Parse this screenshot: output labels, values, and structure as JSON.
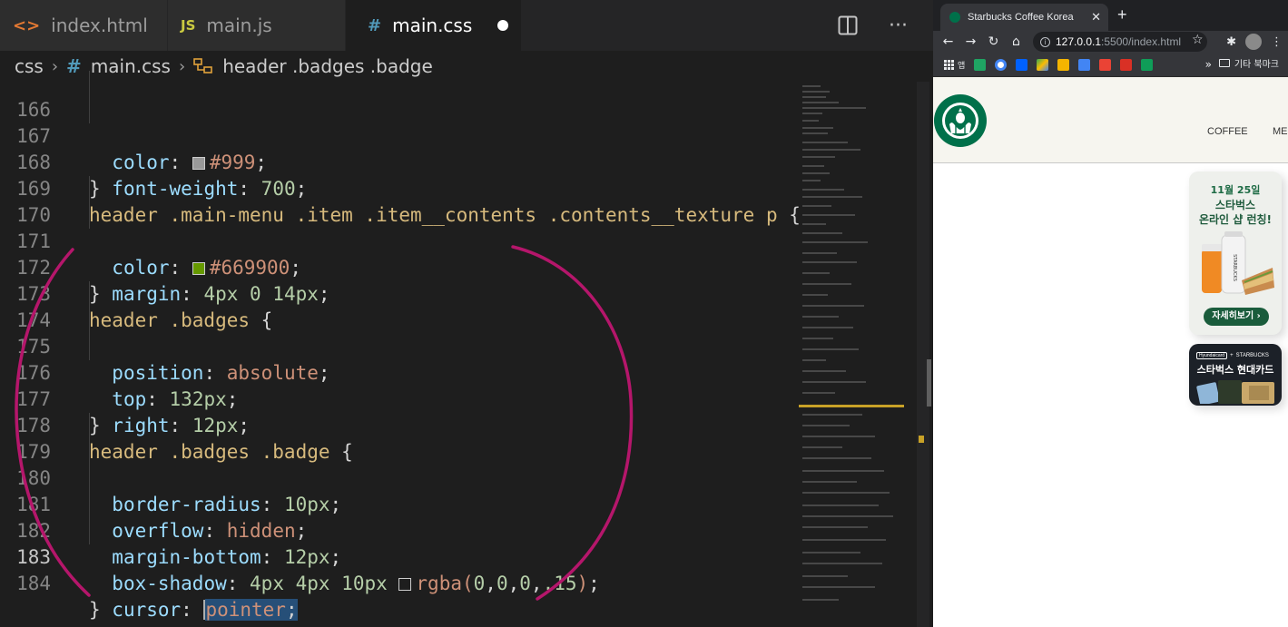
{
  "editor": {
    "tabs": [
      {
        "icon": "<>",
        "label": "index.html",
        "color": "#e37933"
      },
      {
        "icon": "JS",
        "label": "main.js",
        "color": "#cbcb41"
      },
      {
        "icon": "#",
        "label": "main.css",
        "color": "#519aba",
        "unsaved": true
      }
    ],
    "breadcrumb": [
      "css",
      "main.css",
      "header .badges .badge"
    ],
    "lines": [
      {
        "n": "166",
        "code": "  color: #999;"
      },
      {
        "n": "167",
        "code": "  font-weight: 700;"
      },
      {
        "n": "168",
        "code": "}"
      },
      {
        "n": "169",
        "code": "header .main-menu .item .item__contents .contents__texture p {"
      },
      {
        "n": "170",
        "code": "  color: #669900;"
      },
      {
        "n": "171",
        "code": "  margin: 4px 0 14px;"
      },
      {
        "n": "172",
        "code": "}"
      },
      {
        "n": "173",
        "code": "header .badges {"
      },
      {
        "n": "174",
        "code": "  position: absolute;"
      },
      {
        "n": "175",
        "code": "  top: 132px;"
      },
      {
        "n": "176",
        "code": "  right: 12px;"
      },
      {
        "n": "177",
        "code": "}"
      },
      {
        "n": "178",
        "code": "header .badges .badge {"
      },
      {
        "n": "179",
        "code": "  border-radius: 10px;"
      },
      {
        "n": "180",
        "code": "  overflow: hidden;"
      },
      {
        "n": "181",
        "code": "  margin-bottom: 12px;"
      },
      {
        "n": "182",
        "code": "  box-shadow: 4px 4px 10px rgba(0,0,0,.15);"
      },
      {
        "n": "183",
        "code": "  cursor: pointer;"
      },
      {
        "n": "184",
        "code": "}"
      }
    ],
    "current_line": "183",
    "swatch_colors": {
      "gray": "#999999",
      "green": "#669900",
      "shadow": "#000000"
    },
    "annotation_color": "#b5166b"
  },
  "browser": {
    "tab_title": "Starbucks Coffee Korea",
    "url_host": "127.0.0.1",
    "url_rest": ":5500/index.html",
    "bookmark_label": "앱",
    "bookmark_folder": "기타 북마크",
    "menu": [
      "COFFEE",
      "ME"
    ],
    "badge1": {
      "date": "11월 25일",
      "line1": "스타벅스",
      "line2": "온라인 샵 런칭!",
      "button": "자세히보기 ›"
    },
    "badge2": {
      "brand": "Hyundaicard",
      "plus": "+",
      "partner": "STARBUCKS",
      "title": "스타벅스 현대카드"
    },
    "brand_color": "#00704a"
  }
}
